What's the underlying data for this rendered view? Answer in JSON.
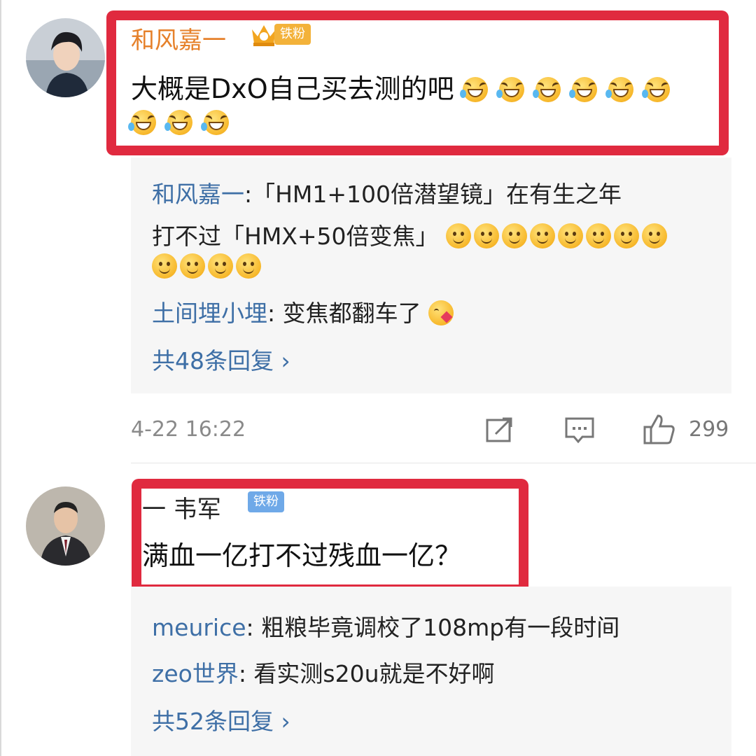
{
  "comments": [
    {
      "username": "和风嘉一",
      "badge": "铁粉",
      "text_line1": "大概是DxO自己买去测的吧",
      "replies": [
        {
          "user": "和风嘉一",
          "text_line1": ":「HM1+100倍潜望镜」在有生之年",
          "text_line2": "打不过「HMX+50倍变焦」"
        },
        {
          "user": "土间埋小埋",
          "text": ": 变焦都翻车了"
        }
      ],
      "more_replies": "共48条回复 ›",
      "time": "4-22 16:22",
      "likes": "299",
      "username_color": "#e6812b"
    },
    {
      "username": "一 韦军",
      "badge": "铁粉",
      "text": "满血一亿打不过残血一亿？",
      "replies": [
        {
          "user": "meurice",
          "text": ": 粗粮毕竟调校了108mp有一段时间"
        },
        {
          "user": "zeo世界",
          "text": ": 看实测s20u就是不好啊"
        }
      ],
      "more_replies": "共52条回复 ›"
    }
  ],
  "icons": {
    "forward": "share-icon",
    "comment": "comment-icon",
    "like": "thumbs-up-icon"
  },
  "colors": {
    "highlight_box": "#e02a3f",
    "link": "#3e6fa6",
    "badge": "#6fa9e8"
  }
}
